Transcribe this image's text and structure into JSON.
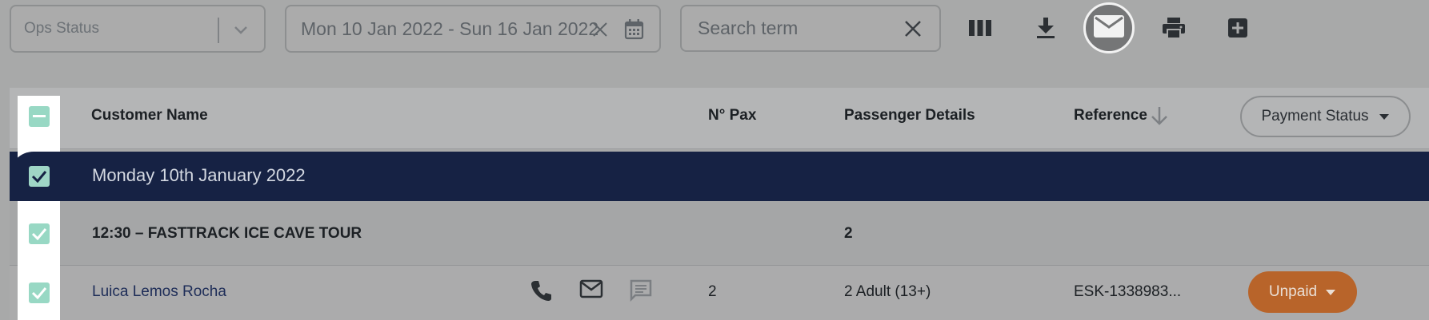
{
  "toolbar": {
    "ops_status_placeholder": "Ops Status",
    "date_range": "Mon 10 Jan 2022 - Sun 16 Jan 2022",
    "search_placeholder": "Search term",
    "icons": [
      "columns-icon",
      "download-icon",
      "mail-icon",
      "print-icon",
      "add-icon"
    ]
  },
  "table": {
    "headers": {
      "customer_name": "Customer Name",
      "pax": "N° Pax",
      "passenger_details": "Passenger Details",
      "reference": "Reference",
      "payment_status": "Payment Status"
    },
    "groups": [
      {
        "date_label": "Monday 10th January 2022",
        "tours": [
          {
            "title": "12:30 – FASTTRACK ICE CAVE TOUR",
            "pax": "2",
            "bookings": [
              {
                "customer_name": "Luica Lemos Rocha",
                "pax": "2",
                "passenger_details": "2 Adult (13+)",
                "reference": "ESK-1338983...",
                "payment_status": "Unpaid"
              }
            ]
          }
        ]
      }
    ]
  },
  "colors": {
    "background": "#a8a9a9",
    "date_row": "#162244",
    "checkbox": "#98d8c4",
    "unpaid": "#b8642a"
  }
}
